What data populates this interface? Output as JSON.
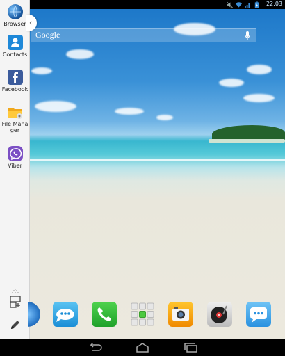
{
  "status_bar": {
    "time": "22:03",
    "icons": [
      "mute-icon",
      "wifi-icon",
      "signal-icon",
      "battery-icon"
    ]
  },
  "search": {
    "logo_text": "Google"
  },
  "side_panel": {
    "collapse_glyph": "‹",
    "apps": [
      {
        "label": "Browser",
        "icon": "globe-icon"
      },
      {
        "label": "Contacts",
        "icon": "contacts-icon"
      },
      {
        "label": "Facebook",
        "icon": "facebook-icon"
      },
      {
        "label": "File Manager",
        "icon": "folder-icon"
      },
      {
        "label": "Viber",
        "icon": "viber-icon"
      }
    ],
    "bottom_icons": [
      "drag-handle-icon",
      "add-app-icon",
      "edit-pencil-icon"
    ]
  },
  "dock": {
    "apps": [
      "browser-partial-icon",
      "messaging-icon",
      "phone-icon",
      "app-drawer-icon",
      "camera-icon",
      "music-icon",
      "messages-icon"
    ]
  },
  "navbar": {
    "buttons": [
      "back-button",
      "home-button",
      "recents-button"
    ]
  }
}
